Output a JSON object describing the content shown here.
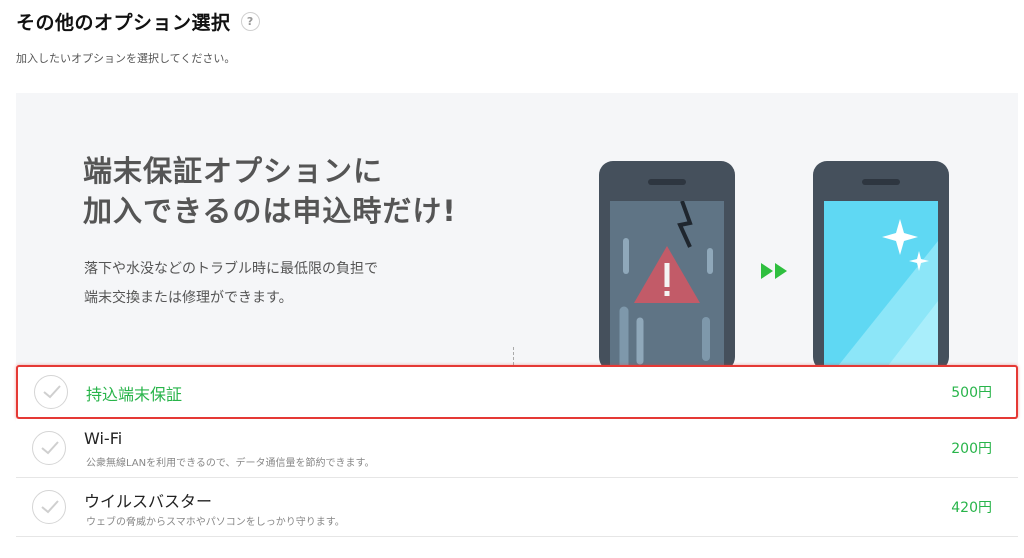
{
  "header": {
    "title": "その他のオプション選択",
    "help_icon_label": "?",
    "subtitle": "加入したいオプションを選択してください。"
  },
  "banner": {
    "headline": [
      "端末保証オプションに",
      "加入できるのは申込時だけ!"
    ],
    "description": [
      "落下や水没などのトラブル時に最低限の負担で",
      "端末交換または修理ができます。"
    ],
    "illustration": {
      "left_phone": "broken-phone-warning-icon",
      "arrow": "double-arrow-right-icon",
      "right_phone": "sparkling-phone-icon"
    }
  },
  "colors": {
    "accent_green": "#28b44a",
    "highlight_red": "#e53935"
  },
  "options": [
    {
      "name": "持込端末保証",
      "description": "",
      "price": "500円",
      "selected_highlight": true
    },
    {
      "name": "Wi-Fi",
      "description": "公衆無線LANを利用できるので、データ通信量を節約できます。",
      "price": "200円",
      "selected_highlight": false
    },
    {
      "name": "ウイルスバスター",
      "description": "ウェブの脅威からスマホやパソコンをしっかり守ります。",
      "price": "420円",
      "selected_highlight": false
    }
  ]
}
